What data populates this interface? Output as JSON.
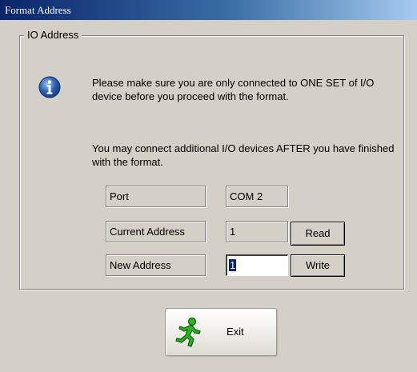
{
  "window": {
    "title": "Format Address"
  },
  "group": {
    "legend": "IO Address"
  },
  "message": {
    "line1": "Please make sure you are only connected to ONE SET of I/O device before you proceed with the format.",
    "line2": "You may connect additional I/O devices AFTER you have finished with the format."
  },
  "fields": {
    "port_label": "Port",
    "port_value": "COM 2",
    "current_label": "Current Address",
    "current_value": "1",
    "new_label": "New Address",
    "new_value": "1"
  },
  "buttons": {
    "read": "Read",
    "write": "Write",
    "exit": "Exit"
  },
  "icons": {
    "info": "info-icon",
    "exit": "running-man-icon"
  },
  "colors": {
    "titlebar_start": "#0a246a",
    "titlebar_end": "#a6caf0",
    "dialog_bg": "#d4d0c8",
    "info_icon": "#2a5db0",
    "exit_icon": "#29b51e"
  }
}
